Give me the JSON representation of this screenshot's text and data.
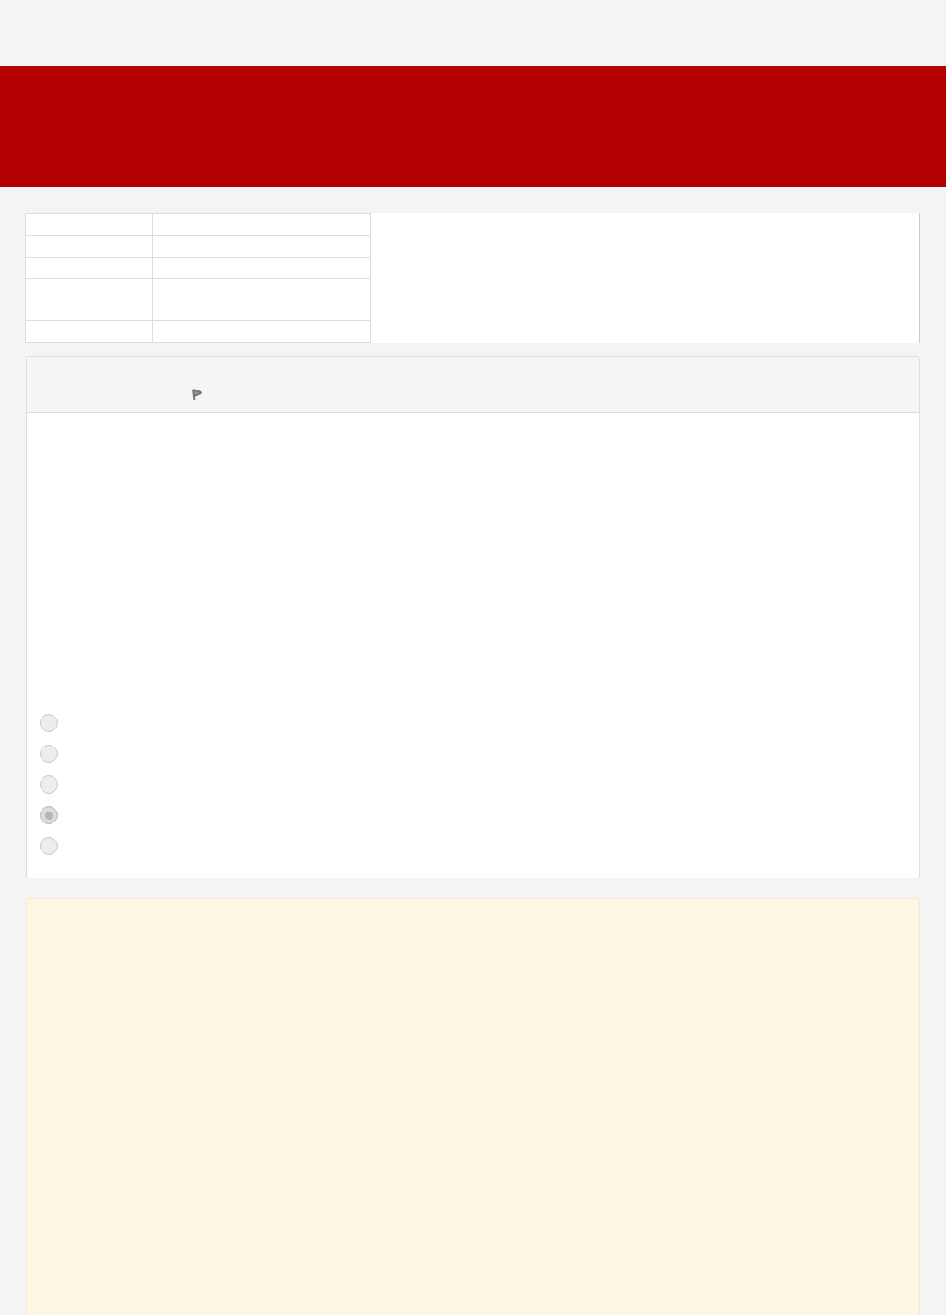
{
  "info_table": {
    "rows": [
      {
        "kind": "single"
      },
      {
        "kind": "single"
      },
      {
        "kind": "single"
      },
      {
        "kind": "double"
      },
      {
        "kind": "single"
      }
    ]
  },
  "question": {
    "flagged": true,
    "options": [
      {
        "selected": false
      },
      {
        "selected": false
      },
      {
        "selected": false
      },
      {
        "selected": true
      },
      {
        "selected": false
      }
    ]
  }
}
